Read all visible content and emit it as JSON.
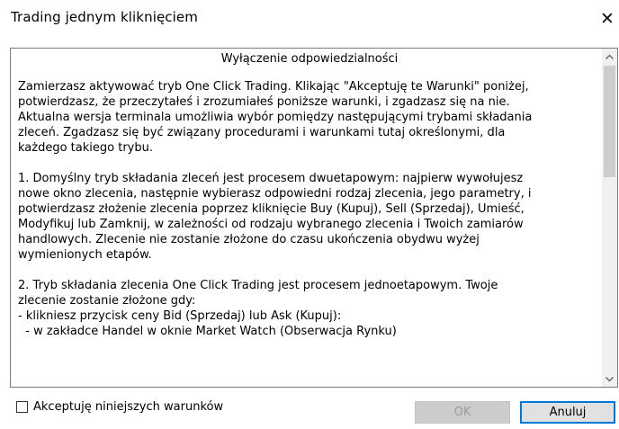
{
  "window": {
    "title": "Trading jednym kliknięciem",
    "close_glyph": "✕"
  },
  "disclaimer": {
    "heading": "Wyłączenie odpowiedzialności",
    "lines": [
      "Zamierzasz aktywować tryb One Click Trading. Klikając \"Akceptuję te Warunki\" poniżej,",
      "potwierdzasz, że przeczytałeś i zrozumiałeś poniższe warunki, i zgadzasz się na nie.",
      "Aktualna wersja terminala umożliwia wybór pomiędzy następującymi trybami składania",
      "zleceń. Zgadzasz się być związany procedurami i warunkami tutaj określonymi, dla",
      "każdego takiego trybu.",
      "",
      "1. Domyślny tryb składania zleceń jest procesem dwuetapowym: najpierw wywołujesz",
      "nowe okno zlecenia, następnie wybierasz odpowiedni rodzaj zlecenia, jego parametry, i",
      "potwierdzasz złożenie zlecenia poprzez kliknięcie Buy (Kupuj), Sell (Sprzedaj), Umieść,",
      "Modyfikuj lub Zamknij, w zależności od rodzaju wybranego zlecenia i Twoich zamiarów",
      "handlowych. Zlecenie nie zostanie złożone do czasu ukończenia obydwu wyżej",
      "wymienionych etapów.",
      "",
      "2. Tryb składania zlecenia One Click Trading jest procesem jednoetapowym. Twoje",
      "zlecenie zostanie złożone gdy:",
      "- klikniesz przycisk ceny Bid (Sprzedaj) lub Ask (Kupuj):",
      "  - w zakładce Handel w oknie Market Watch (Obserwacja Rynku)"
    ]
  },
  "accept_checkbox": {
    "label": "Akceptuję niniejszych warunków",
    "checked": false
  },
  "buttons": {
    "ok": "OK",
    "cancel": "Anuluj"
  },
  "colors": {
    "focus_border": "#0078d7",
    "disabled_bg": "#cccccc",
    "disabled_text": "#9c9c9c"
  }
}
